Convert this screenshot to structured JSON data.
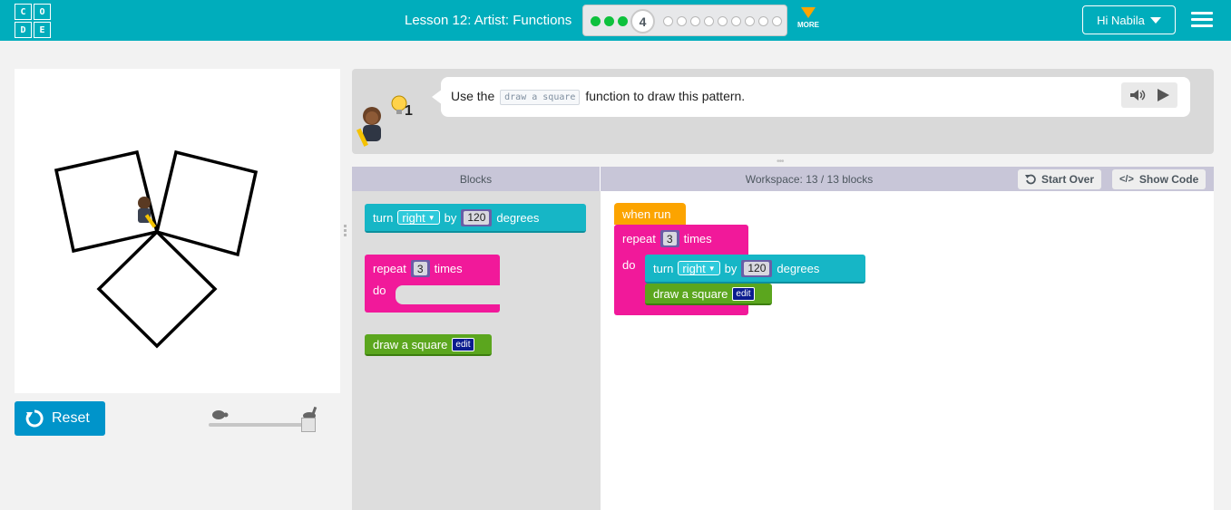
{
  "header": {
    "logo_letters": [
      "C",
      "O",
      "D",
      "E"
    ],
    "lesson_title": "Lesson 12: Artist: Functions",
    "progress": {
      "completed_count": 3,
      "current_level": "4",
      "remaining_count": 10
    },
    "more_label": "MORE",
    "user_label": "Hi Nabila"
  },
  "visualization": {
    "reset_label": "Reset",
    "speed": 1.0
  },
  "instructions": {
    "prefix": "Use the",
    "code": "draw a square",
    "suffix": "function to draw this pattern.",
    "hint_count": "1"
  },
  "workspace_header": {
    "blocks_label": "Blocks",
    "workspace_label": "Workspace: 13 / 13 blocks",
    "start_over_label": "Start Over",
    "show_code_label": "Show Code"
  },
  "toolbox": {
    "turn": {
      "turn": "turn",
      "direction": "right",
      "by": "by",
      "amount": "120",
      "degrees": "degrees"
    },
    "repeat": {
      "repeat": "repeat",
      "count": "3",
      "times": "times",
      "do": "do"
    },
    "draw": {
      "label": "draw a square",
      "edit": "edit"
    }
  },
  "program": {
    "when_run": "when run",
    "repeat": "repeat",
    "count": "3",
    "times": "times",
    "do": "do",
    "turn": "turn",
    "direction": "right",
    "by": "by",
    "amount": "120",
    "degrees": "degrees",
    "draw_label": "draw a square",
    "edit": "edit"
  },
  "colors": {
    "header": "#00adbc",
    "reset": "#0094ca",
    "teal_block": "#16b6c6",
    "pink_block": "#f1199a",
    "green_block": "#5ba61e",
    "orange_block": "#fca400"
  }
}
